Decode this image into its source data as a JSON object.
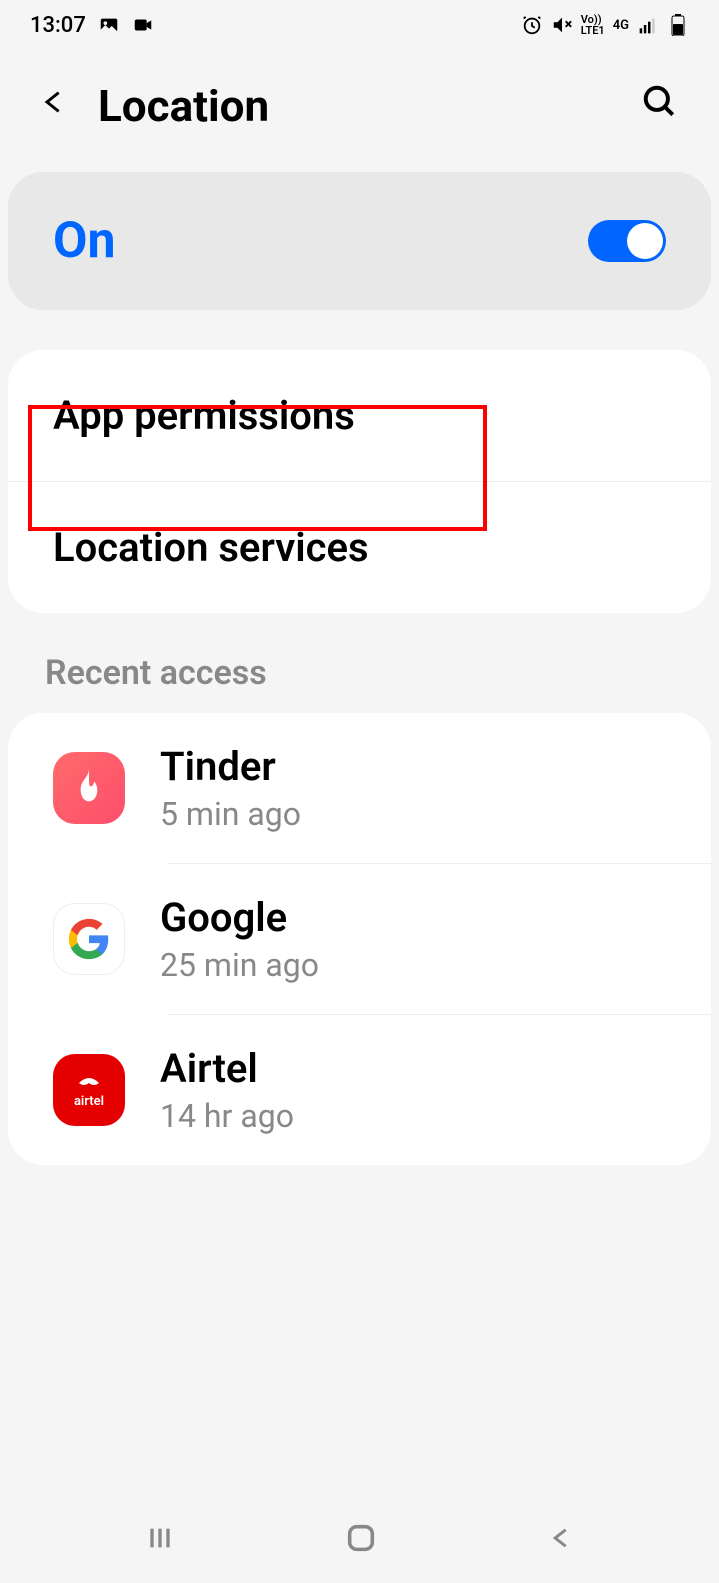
{
  "status_bar": {
    "time": "13:07",
    "network": "4G",
    "lte": "LTE1",
    "volte": "Vo))"
  },
  "header": {
    "title": "Location"
  },
  "toggle": {
    "label": "On",
    "enabled": true
  },
  "settings": {
    "app_permissions": "App permissions",
    "location_services": "Location services"
  },
  "recent": {
    "header": "Recent access",
    "items": [
      {
        "name": "Tinder",
        "time": "5 min ago",
        "icon": "tinder"
      },
      {
        "name": "Google",
        "time": "25 min ago",
        "icon": "google"
      },
      {
        "name": "Airtel",
        "time": "14 hr ago",
        "icon": "airtel"
      }
    ]
  },
  "highlight": {
    "target": "app_permissions"
  }
}
